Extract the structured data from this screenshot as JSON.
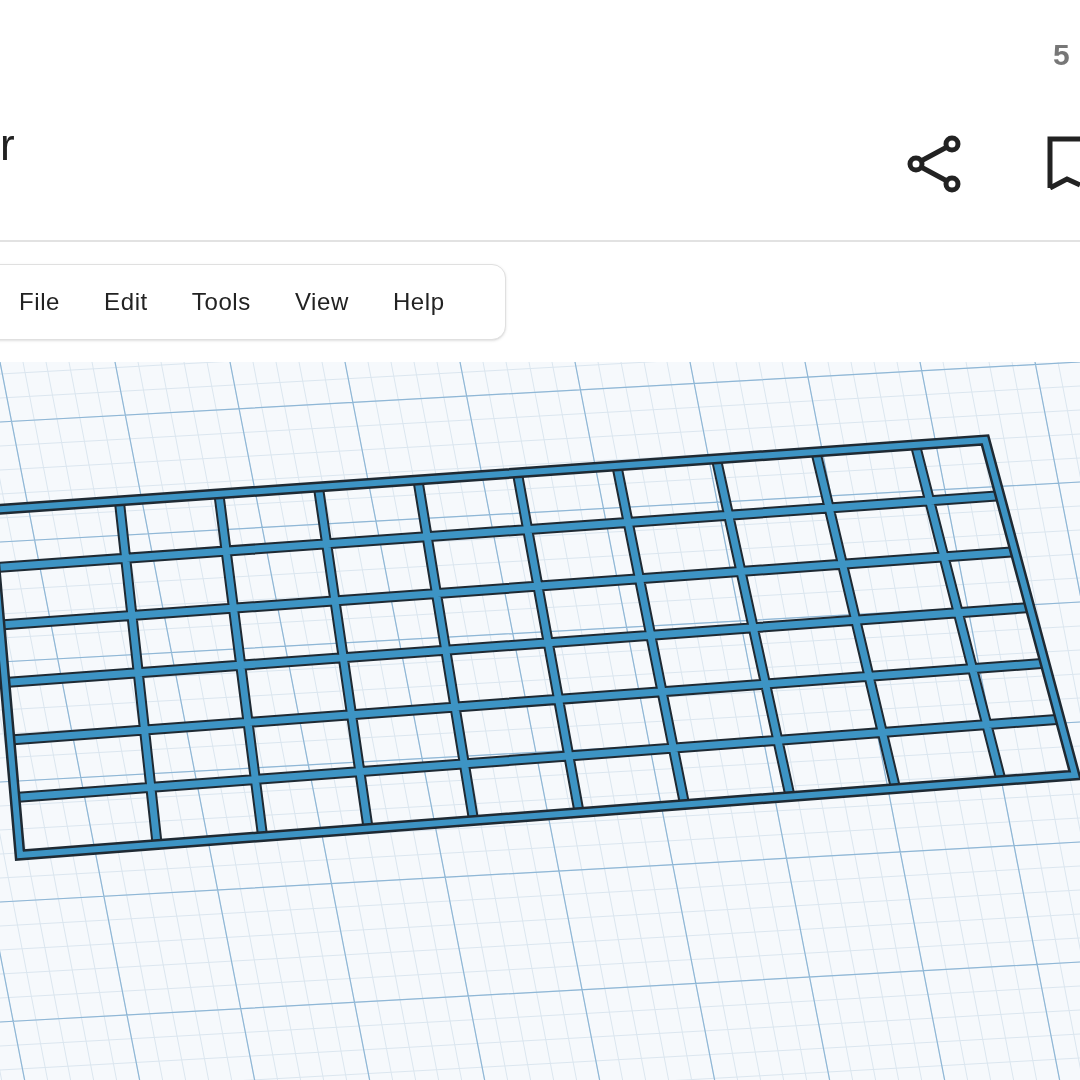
{
  "header": {
    "title": "r",
    "count": "5"
  },
  "menu": [
    {
      "label": "File"
    },
    {
      "label": "Edit"
    },
    {
      "label": "Tools"
    },
    {
      "label": "View"
    },
    {
      "label": "Help"
    }
  ]
}
